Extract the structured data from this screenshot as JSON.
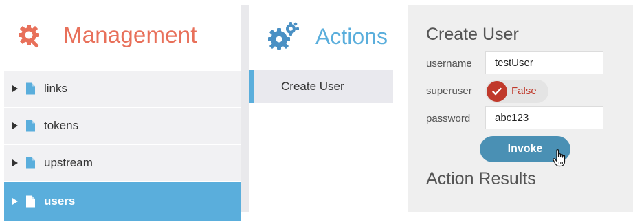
{
  "management": {
    "title": "Management",
    "items": [
      {
        "label": "links",
        "active": false
      },
      {
        "label": "tokens",
        "active": false
      },
      {
        "label": "upstream",
        "active": false
      },
      {
        "label": "users",
        "active": true
      }
    ]
  },
  "actions": {
    "title": "Actions",
    "items": [
      {
        "label": "Create User",
        "selected": true
      }
    ]
  },
  "create_user": {
    "title": "Create User",
    "fields": {
      "username": {
        "label": "username",
        "value": "testUser"
      },
      "superuser": {
        "label": "superuser",
        "value": "False"
      },
      "password": {
        "label": "password",
        "value": "abc123"
      }
    },
    "invoke_label": "Invoke",
    "results_title": "Action Results"
  },
  "colors": {
    "management_accent": "#e8705a",
    "actions_accent": "#5aaedc",
    "active_item_bg": "#5aaedc",
    "toggle_false": "#c0392b",
    "invoke_bg": "#4a90b4"
  }
}
